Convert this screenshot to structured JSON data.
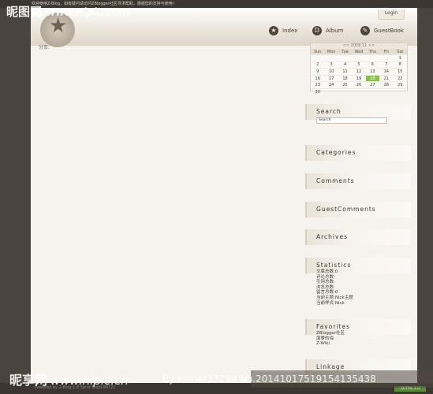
{
  "topbar": {
    "text": "欢迎使用Z-Blog，如有疑问请访问ZBlogger社区寻求帮助，感谢您的支持与使用！"
  },
  "header": {
    "title": "",
    "login": "Login",
    "nav": [
      {
        "label": "Index",
        "icon": "star-icon"
      },
      {
        "label": "Album",
        "icon": "album-icon"
      },
      {
        "label": "GuestBook",
        "icon": "guestbook-icon"
      }
    ]
  },
  "content": {
    "breadcrumb": "分页:"
  },
  "calendar": {
    "title": "<< 2008.11 >>",
    "weekdays": [
      "Sun",
      "Mon",
      "Tue",
      "Wed",
      "Thu",
      "Fri",
      "Sat"
    ],
    "weeks": [
      [
        "",
        "",
        "",
        "",
        "",
        "",
        "1"
      ],
      [
        "2",
        "3",
        "4",
        "5",
        "6",
        "7",
        "8"
      ],
      [
        "9",
        "10",
        "11",
        "12",
        "13",
        "14",
        "15"
      ],
      [
        "16",
        "17",
        "18",
        "19",
        "20",
        "21",
        "22"
      ],
      [
        "23",
        "24",
        "25",
        "26",
        "27",
        "28",
        "29"
      ],
      [
        "30",
        "",
        "",
        "",
        "",
        "",
        ""
      ]
    ],
    "today": "20"
  },
  "sidebar": {
    "search_title": "Search",
    "search_value": "Search",
    "categories_title": "Categories",
    "comments_title": "Comments",
    "guestcomments_title": "GuestComments",
    "archives_title": "Archives",
    "statistics_title": "Statistics",
    "statistics": [
      "文章总数:0",
      "评论总数:",
      "引用总数:",
      "浏览总数:",
      "留言总数:0",
      "当前主题:Nick主题",
      "当前样式:Nick"
    ],
    "favorites_title": "Favorites",
    "favorites": [
      "ZBlogger社区",
      "菠萝的海",
      "Z-Wiki"
    ],
    "linkage_title": "Linkage"
  },
  "footer": {
    "text": "Powered by Z-Blog 1.8 Spirit Build 80722",
    "badge": "XHTML 1.0"
  },
  "watermarks": {
    "top_logo": "昵图网",
    "top_url": "www.nipic.com",
    "bottom_logo": "昵享网",
    "bottom_url": "www.nipic.cn",
    "id_text": "By:xianer33299  No.20141017519154135438"
  },
  "colors": {
    "background": "#4a4440",
    "page": "#f6f3ee",
    "today": "#8bbf4d",
    "text": "#3f3931"
  }
}
